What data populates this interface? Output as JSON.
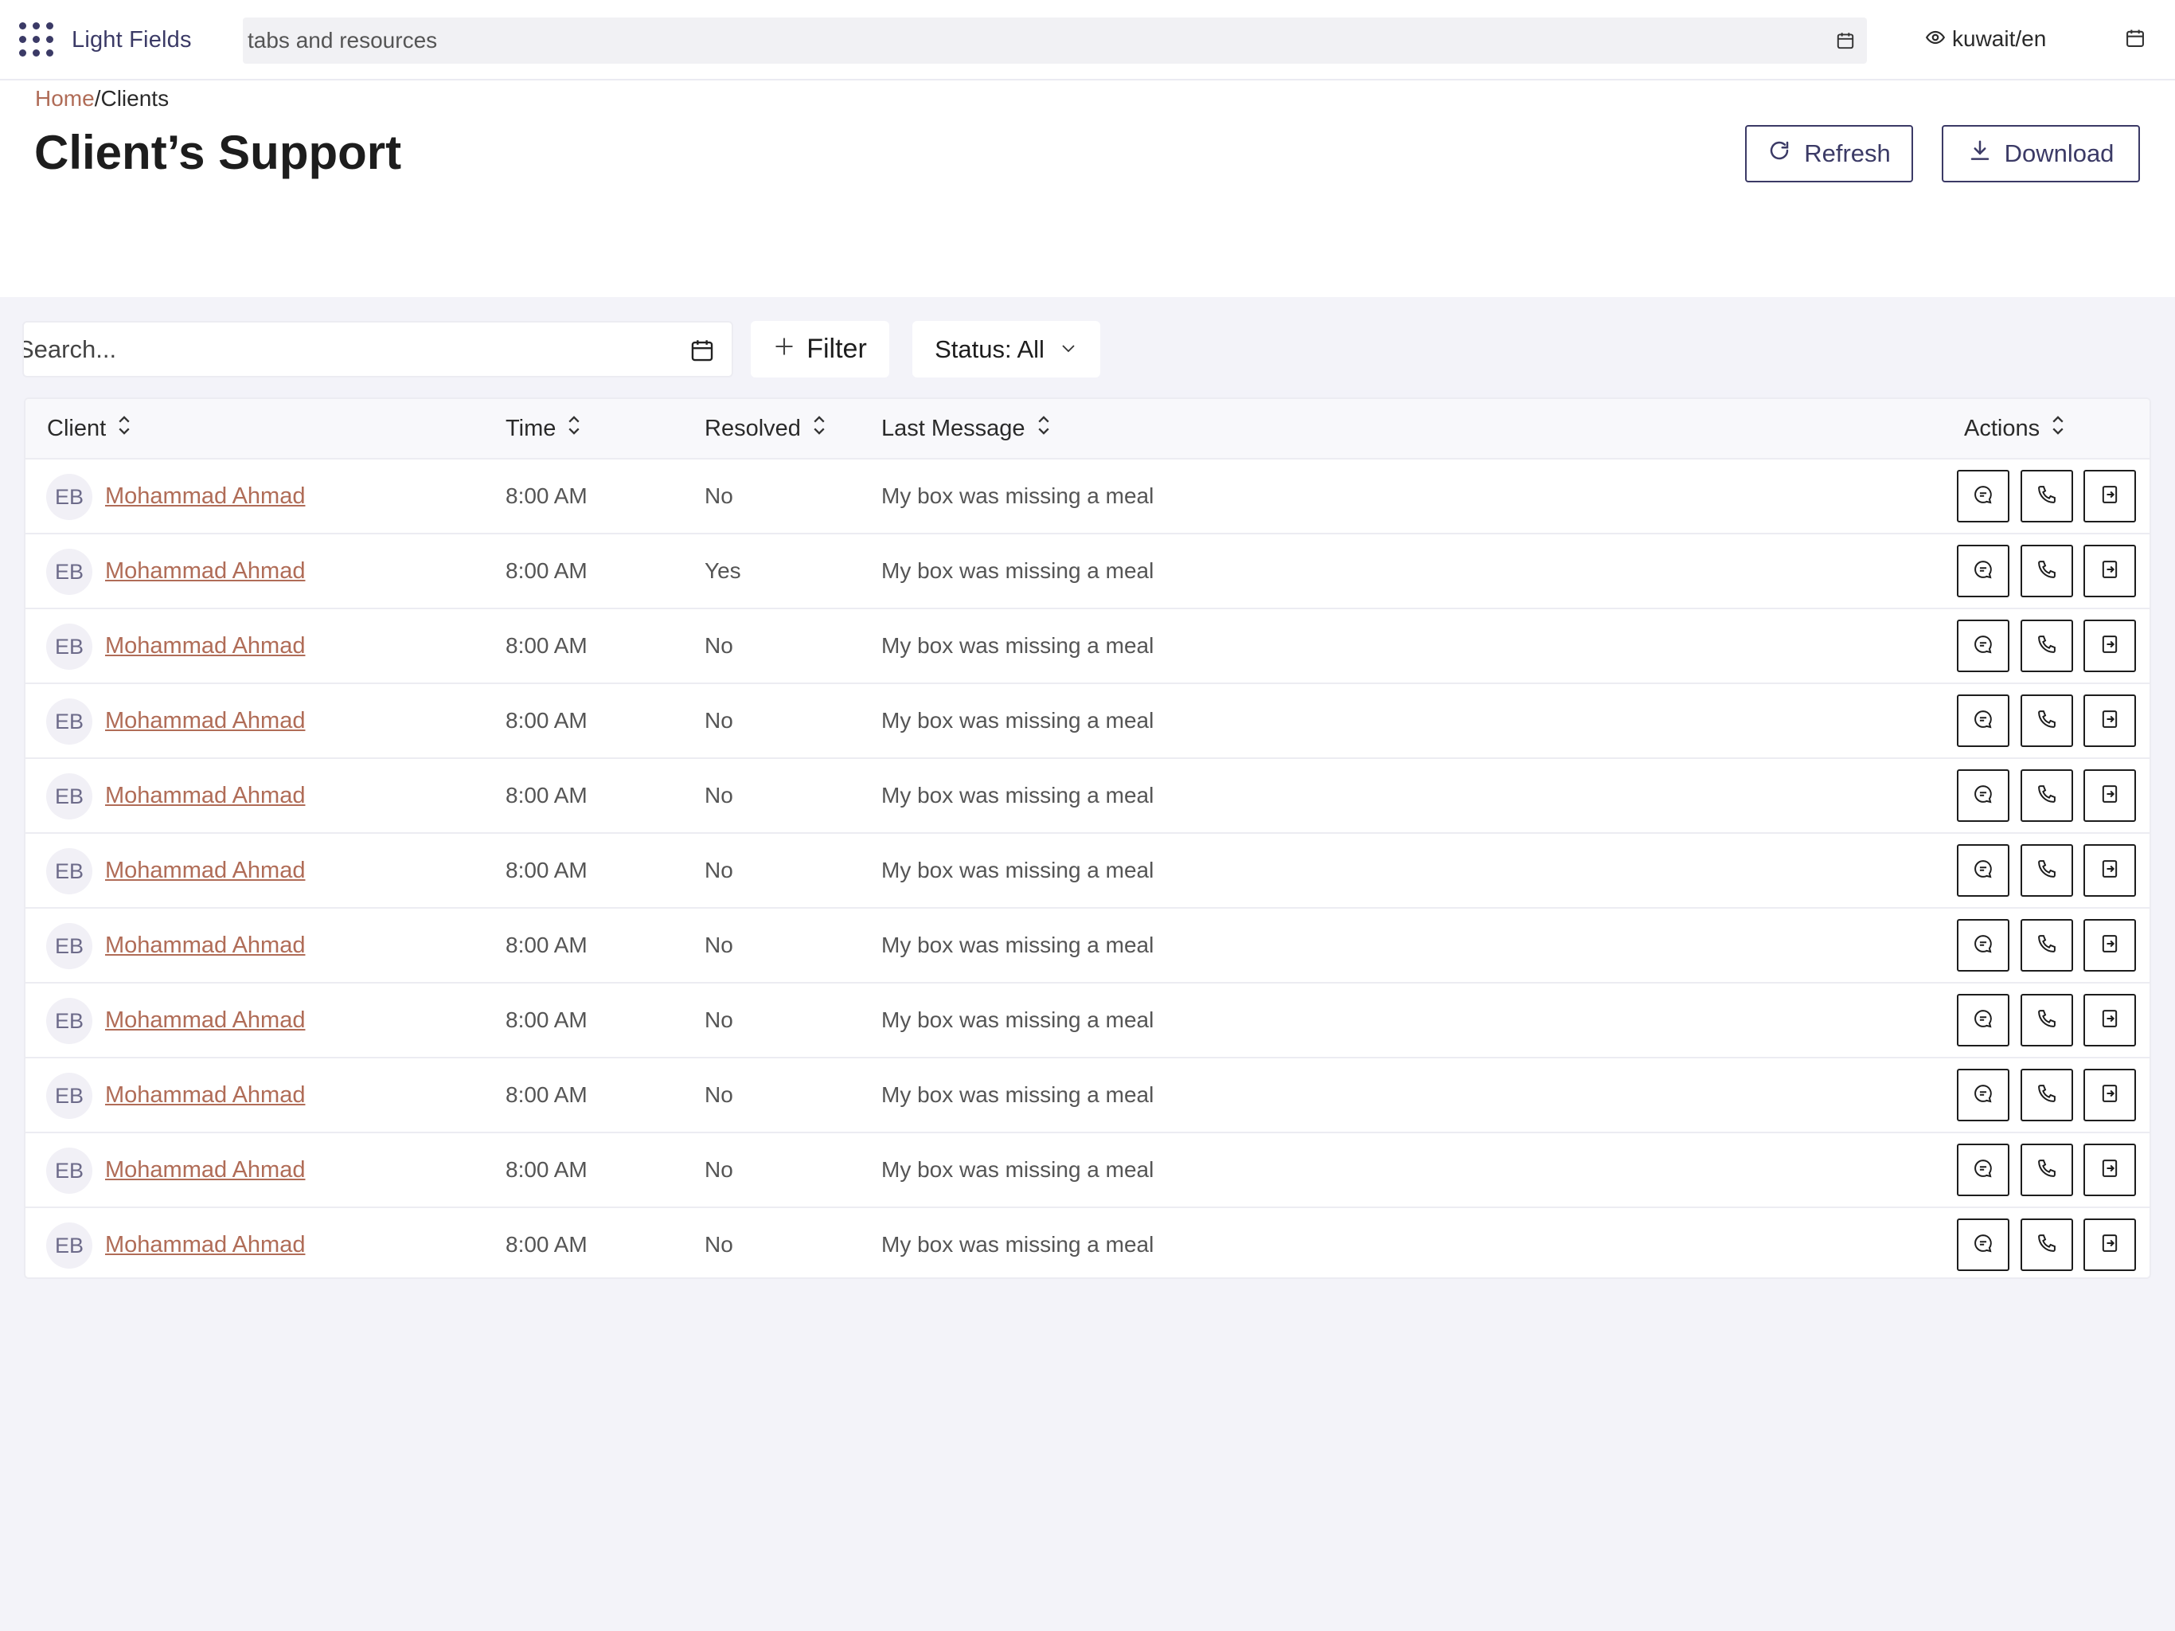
{
  "app": {
    "name": "Light Fields"
  },
  "topbar": {
    "search_placeholder": "tabs and resources",
    "locale": "kuwait/en"
  },
  "breadcrumb": {
    "home": "Home",
    "separator": "/",
    "current": "Clients"
  },
  "page": {
    "title": "Client’s Support"
  },
  "buttons": {
    "refresh": "Refresh",
    "download": "Download"
  },
  "toolbar": {
    "search_placeholder": "Search...",
    "filter_label": "Filter",
    "status_label": "Status: All"
  },
  "table": {
    "columns": [
      "Client",
      "Time",
      "Resolved",
      "Last Message",
      "Actions"
    ],
    "rows": [
      {
        "initials": "EB",
        "client": "Mohammad Ahmad",
        "time": "8:00 AM",
        "resolved": "No",
        "message": "My box was missing a meal"
      },
      {
        "initials": "EB",
        "client": "Mohammad Ahmad",
        "time": "8:00 AM",
        "resolved": "Yes",
        "message": "My box was missing a meal"
      },
      {
        "initials": "EB",
        "client": "Mohammad Ahmad",
        "time": "8:00 AM",
        "resolved": "No",
        "message": "My box was missing a meal"
      },
      {
        "initials": "EB",
        "client": "Mohammad Ahmad",
        "time": "8:00 AM",
        "resolved": "No",
        "message": "My box was missing a meal"
      },
      {
        "initials": "EB",
        "client": "Mohammad Ahmad",
        "time": "8:00 AM",
        "resolved": "No",
        "message": "My box was missing a meal"
      },
      {
        "initials": "EB",
        "client": "Mohammad Ahmad",
        "time": "8:00 AM",
        "resolved": "No",
        "message": "My box was missing a meal"
      },
      {
        "initials": "EB",
        "client": "Mohammad Ahmad",
        "time": "8:00 AM",
        "resolved": "No",
        "message": "My box was missing a meal"
      },
      {
        "initials": "EB",
        "client": "Mohammad Ahmad",
        "time": "8:00 AM",
        "resolved": "No",
        "message": "My box was missing a meal"
      },
      {
        "initials": "EB",
        "client": "Mohammad Ahmad",
        "time": "8:00 AM",
        "resolved": "No",
        "message": "My box was missing a meal"
      },
      {
        "initials": "EB",
        "client": "Mohammad Ahmad",
        "time": "8:00 AM",
        "resolved": "No",
        "message": "My box was missing a meal"
      },
      {
        "initials": "EB",
        "client": "Mohammad Ahmad",
        "time": "8:00 AM",
        "resolved": "No",
        "message": "My box was missing a meal"
      }
    ]
  },
  "icons": {
    "apps": "grid-dots-icon",
    "calendar": "calendar-icon",
    "eye": "eye-icon",
    "refresh": "refresh-icon",
    "download": "download-icon",
    "plus": "plus-icon",
    "chevron": "chevron-down-icon",
    "sort": "sort-icon",
    "message": "message-icon",
    "phone": "phone-icon",
    "exit": "exit-icon"
  },
  "colors": {
    "brand": "#3b3a66",
    "link": "#b06c57",
    "background": "#f3f3f9"
  }
}
